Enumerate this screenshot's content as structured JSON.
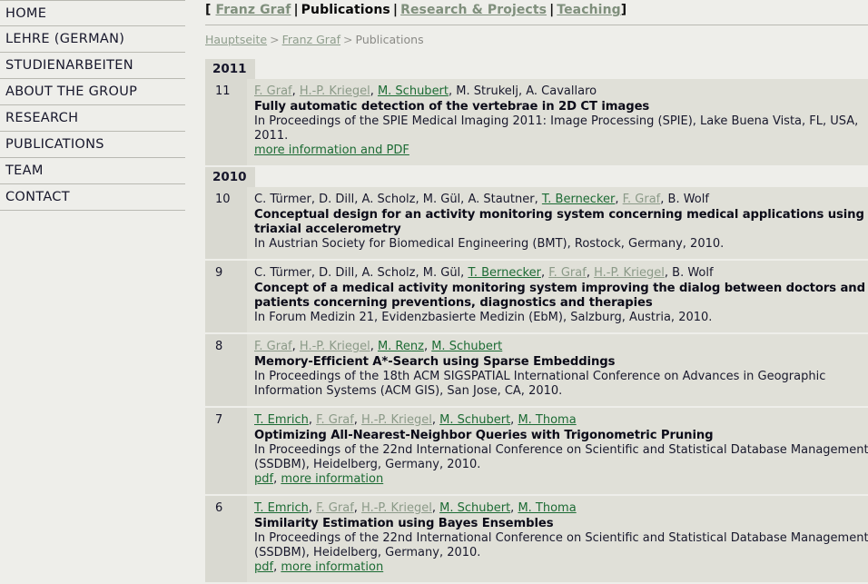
{
  "sidebar": {
    "items": [
      {
        "label": "HOME",
        "name": "home"
      },
      {
        "label": "LEHRE (GERMAN)",
        "name": "lehre-german"
      },
      {
        "label": "STUDIENARBEITEN",
        "name": "studienarbeiten"
      },
      {
        "label": "ABOUT THE GROUP",
        "name": "about-the-group"
      },
      {
        "label": "RESEARCH",
        "name": "research"
      },
      {
        "label": "PUBLICATIONS",
        "name": "publications"
      },
      {
        "label": "TEAM",
        "name": "team"
      },
      {
        "label": "CONTACT",
        "name": "contact"
      }
    ]
  },
  "topnav": {
    "open_bracket": "[",
    "close_bracket": "]",
    "separator": "|",
    "items": [
      {
        "label": "Franz Graf",
        "state": "visited"
      },
      {
        "label": "Publications",
        "state": "current"
      },
      {
        "label": "Research & Projects",
        "state": "visited"
      },
      {
        "label": "Teaching",
        "state": "visited"
      }
    ]
  },
  "breadcrumb": {
    "separator": ">",
    "items": [
      {
        "label": "Hauptseite",
        "state": "link"
      },
      {
        "label": "Franz Graf",
        "state": "link"
      },
      {
        "label": "Publications",
        "state": "current"
      }
    ]
  },
  "colors": {
    "page_background": "#eeeeea",
    "entry_background": "#e0e0d8",
    "number_column_background": "#d9d9d1",
    "year_box_background": "#d9d9d1",
    "link_green": "#1c6b34",
    "link_visited": "#8b9a88",
    "text": "#18182c",
    "rule": "#b9b9b2"
  },
  "publications": [
    {
      "year": "2011",
      "entries": [
        {
          "number": "11",
          "authors": [
            {
              "text": "F. Graf",
              "type": "link-visited"
            },
            {
              "text": "H.-P. Kriegel",
              "type": "link-visited"
            },
            {
              "text": "M. Schubert",
              "type": "link"
            },
            {
              "text": "M. Strukelj",
              "type": "plain"
            },
            {
              "text": "A. Cavallaro",
              "type": "plain"
            }
          ],
          "title": "Fully automatic detection of the vertebrae in 2D CT images",
          "venue": "In Proceedings of the SPIE Medical Imaging 2011: Image Processing (SPIE), Lake Buena Vista, FL, USA, 2011.",
          "links": [
            {
              "text": "more information and PDF"
            }
          ]
        }
      ]
    },
    {
      "year": "2010",
      "entries": [
        {
          "number": "10",
          "authors": [
            {
              "text": "C. Türmer",
              "type": "plain"
            },
            {
              "text": "D. Dill",
              "type": "plain"
            },
            {
              "text": "A. Scholz",
              "type": "plain"
            },
            {
              "text": "M. Gül",
              "type": "plain"
            },
            {
              "text": "A. Stautner",
              "type": "plain"
            },
            {
              "text": "T. Bernecker",
              "type": "link"
            },
            {
              "text": "F. Graf",
              "type": "link-visited"
            },
            {
              "text": "B. Wolf",
              "type": "plain"
            }
          ],
          "title": "Conceptual design for an activity monitoring system concerning medical applications using triaxial accelerometry",
          "venue": "In Austrian Society for Biomedical Engineering (BMT), Rostock, Germany, 2010.",
          "links": []
        },
        {
          "number": "9",
          "authors": [
            {
              "text": "C. Türmer",
              "type": "plain"
            },
            {
              "text": "D. Dill",
              "type": "plain"
            },
            {
              "text": "A. Scholz",
              "type": "plain"
            },
            {
              "text": "M. Gül",
              "type": "plain"
            },
            {
              "text": "T. Bernecker",
              "type": "link"
            },
            {
              "text": "F. Graf",
              "type": "link-visited"
            },
            {
              "text": "H.-P. Kriegel",
              "type": "link-visited"
            },
            {
              "text": "B. Wolf",
              "type": "plain"
            }
          ],
          "title": "Concept of a medical activity monitoring system improving the dialog between doctors and patients concerning preventions, diagnostics and therapies",
          "venue": "In Forum Medizin 21, Evidenzbasierte Medizin (EbM), Salzburg, Austria, 2010.",
          "links": []
        },
        {
          "number": "8",
          "authors": [
            {
              "text": "F. Graf",
              "type": "link-visited"
            },
            {
              "text": "H.-P. Kriegel",
              "type": "link-visited"
            },
            {
              "text": "M. Renz",
              "type": "link"
            },
            {
              "text": "M. Schubert",
              "type": "link"
            }
          ],
          "title": "Memory-Efficient A*-Search using Sparse Embeddings",
          "venue": "In Proceedings of the 18th ACM SIGSPATIAL International Conference on Advances in Geographic Information Systems (ACM GIS), San Jose, CA, 2010.",
          "links": []
        },
        {
          "number": "7",
          "authors": [
            {
              "text": "T. Emrich",
              "type": "link"
            },
            {
              "text": "F. Graf",
              "type": "link-visited"
            },
            {
              "text": "H.-P. Kriegel",
              "type": "link-visited"
            },
            {
              "text": "M. Schubert",
              "type": "link"
            },
            {
              "text": "M. Thoma",
              "type": "link"
            }
          ],
          "title": "Optimizing All-Nearest-Neighbor Queries with Trigonometric Pruning",
          "venue": "In Proceedings of the 22nd International Conference on Scientific and Statistical Database Management (SSDBM), Heidelberg, Germany, 2010.",
          "links": [
            {
              "text": "pdf"
            },
            {
              "text": "more information"
            }
          ]
        },
        {
          "number": "6",
          "authors": [
            {
              "text": "T. Emrich",
              "type": "link"
            },
            {
              "text": "F. Graf",
              "type": "link-visited"
            },
            {
              "text": "H.-P. Kriegel",
              "type": "link-visited"
            },
            {
              "text": "M. Schubert",
              "type": "link"
            },
            {
              "text": "M. Thoma",
              "type": "link"
            }
          ],
          "title": "Similarity Estimation using Bayes Ensembles",
          "venue": "In Proceedings of the 22nd International Conference on Scientific and Statistical Database Management (SSDBM), Heidelberg, Germany, 2010.",
          "links": [
            {
              "text": "pdf"
            },
            {
              "text": "more information"
            }
          ]
        }
      ]
    }
  ]
}
